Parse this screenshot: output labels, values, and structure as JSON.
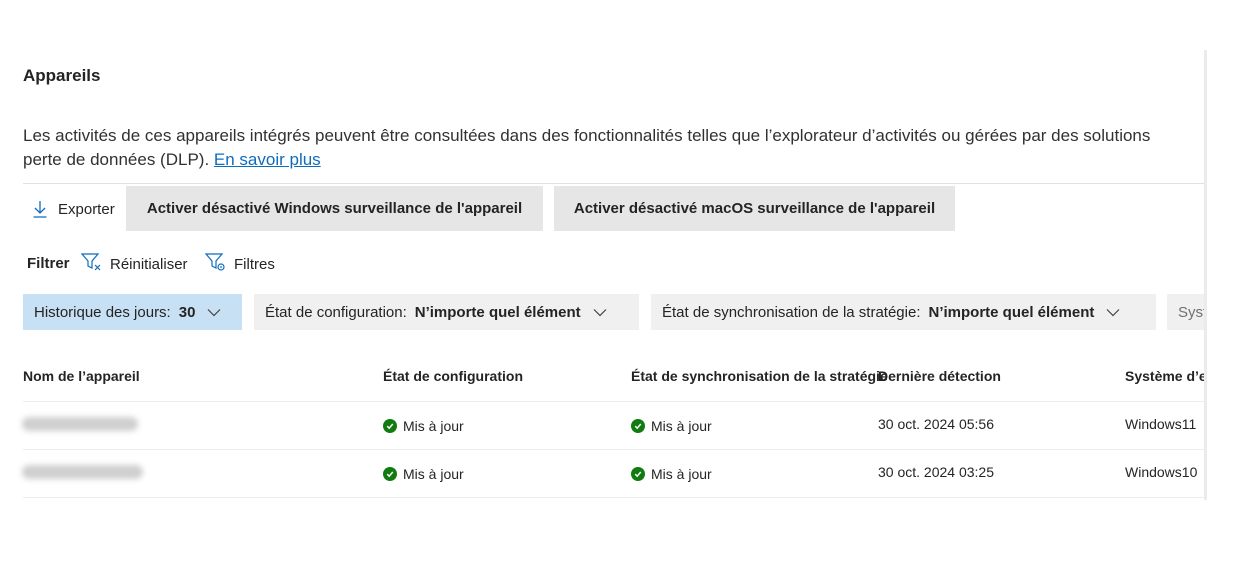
{
  "title": "Appareils",
  "description": {
    "line1": "Les activités de ces appareils intégrés peuvent être consultées dans des fonctionnalités telles que l’explorateur d’activités ou gérées par des solutions",
    "line2": "perte de données (DLP).",
    "link": "En savoir plus"
  },
  "toolbar": {
    "export_label": "Exporter",
    "windows_button": "Activer désactivé Windows surveillance de l'appareil",
    "macos_button": "Activer désactivé macOS surveillance de l'appareil"
  },
  "filters": {
    "label": "Filtrer",
    "reset_label": "Réinitialiser",
    "filters_label": "Filtres",
    "pills": [
      {
        "label": "Historique des jours:",
        "value": "30"
      },
      {
        "label": "État de configuration:",
        "value": "N’importe quel élément"
      },
      {
        "label": "État de synchronisation de la stratégie:",
        "value": "N’importe quel élément"
      },
      {
        "label": "Syst"
      }
    ]
  },
  "table": {
    "columns": [
      "Nom de l’appareil",
      "État de configuration",
      "État de synchronisation de la stratégie",
      "Dernière détection",
      "Système d’ex"
    ],
    "rows": [
      {
        "config": "Mis à jour",
        "sync": "Mis à jour",
        "last_seen": "30 oct. 2024 05:56",
        "os": "Windows11"
      },
      {
        "config": "Mis à jour",
        "sync": "Mis à jour",
        "last_seen": "30 oct. 2024 03:25",
        "os": "Windows10"
      }
    ]
  },
  "colors": {
    "accent": "#0f6cbd",
    "selected_pill": "#c7e0f4",
    "success": "#107c10"
  }
}
